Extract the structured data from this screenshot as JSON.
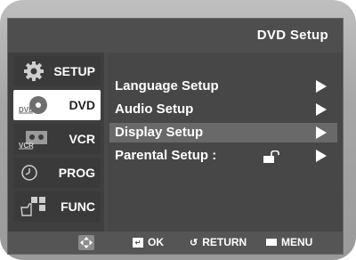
{
  "header": {
    "title": "DVD  Setup"
  },
  "sidebar": {
    "items": [
      {
        "label": "SETUP",
        "icon": "gear-icon",
        "active": false
      },
      {
        "label": "DVD",
        "icon": "dvd-disc-icon",
        "active": true
      },
      {
        "label": "VCR",
        "icon": "vcr-cassette-icon",
        "active": false
      },
      {
        "label": "PROG",
        "icon": "clock-icon",
        "active": false
      },
      {
        "label": "FUNC",
        "icon": "func-hand-icon",
        "active": false
      }
    ]
  },
  "menu": {
    "items": [
      {
        "label": "Language Setup",
        "highlighted": false
      },
      {
        "label": "Audio Setup",
        "highlighted": false
      },
      {
        "label": "Display Setup",
        "highlighted": true
      },
      {
        "label": "Parental Setup :",
        "highlighted": false,
        "status_icon": "unlocked-padlock-icon"
      }
    ]
  },
  "footer": {
    "nav_icon": "dpad-icon",
    "ok_label": "OK",
    "return_label": "RETURN",
    "menu_label": "MENU"
  },
  "colors": {
    "screen_bg": "#4a4a4a",
    "active_tab_bg": "#ffffff",
    "highlight_bg": "#696969",
    "text": "#ffffff"
  }
}
